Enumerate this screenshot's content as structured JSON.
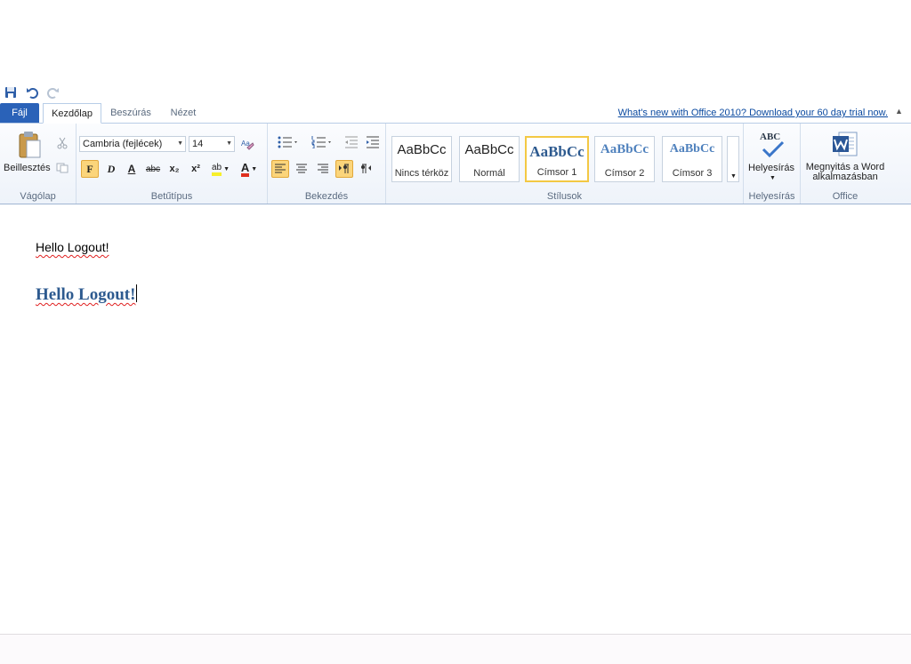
{
  "quick_access": {
    "save_icon": "save-icon",
    "undo_icon": "undo-icon",
    "redo_icon": "redo-icon"
  },
  "tabs": {
    "file": "Fájl",
    "items": [
      "Kezdőlap",
      "Beszúrás",
      "Nézet"
    ],
    "active": "Kezdőlap"
  },
  "promo_link": "What's new with Office 2010? Download your 60 day trial now.",
  "ribbon": {
    "clipboard": {
      "paste_label": "Beillesztés",
      "group_label": "Vágólap"
    },
    "font": {
      "font_name": "Cambria (fejlécek)",
      "font_size": "14",
      "bold_glyph": "F",
      "italic_glyph": "D",
      "underline_glyph": "A",
      "strike_glyph": "abc",
      "subscript_glyph": "x₂",
      "superscript_glyph": "x²",
      "highlight_glyph": "ab",
      "font_color_glyph": "A",
      "group_label": "Betűtípus"
    },
    "paragraph": {
      "group_label": "Bekezdés"
    },
    "styles": {
      "tiles": [
        {
          "sample": "AaBbCc",
          "name": "Nincs térköz"
        },
        {
          "sample": "AaBbCc",
          "name": "Normál"
        },
        {
          "sample": "AaBbCc",
          "name": "Címsor 1"
        },
        {
          "sample": "AaBbCc",
          "name": "Címsor 2"
        },
        {
          "sample": "AaBbCc",
          "name": "Címsor 3"
        }
      ],
      "group_label": "Stílusok"
    },
    "proofing": {
      "spell_label": "Helyesírás",
      "abc": "ABC",
      "group_label": "Helyesírás"
    },
    "office": {
      "open_label_1": "Megnyitás a Word",
      "open_label_2": "alkalmazásban",
      "group_label": "Office"
    }
  },
  "document": {
    "paragraph_text": "Hello Logout!",
    "heading_text": "Hello Logout!"
  },
  "colors": {
    "accent": "#2a62b8",
    "heading": "#2d5a8f",
    "selected": "#fbd57b"
  }
}
